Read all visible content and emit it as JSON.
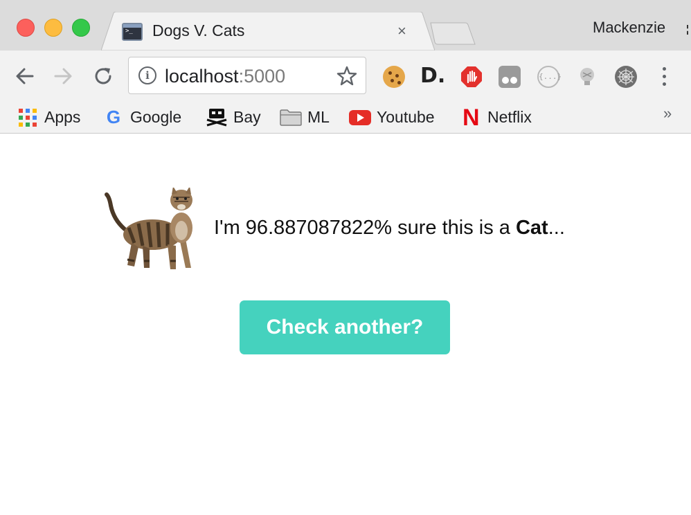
{
  "tab": {
    "title": "Dogs V. Cats",
    "close_glyph": "×",
    "favicon": "terminal-icon"
  },
  "profile": {
    "name": "Mackenzie"
  },
  "toolbar": {
    "back_icon": "arrow-left-icon",
    "forward_icon": "arrow-right-icon",
    "reload_icon": "reload-icon",
    "url_host": "localhost",
    "url_port": ":5000",
    "info_glyph": "i",
    "star_icon": "star-outline-icon",
    "extensions": [
      "cookie-icon",
      "d-logo-icon",
      "stop-hand-icon",
      "glasses-icon",
      "json-braces-icon",
      "bulb-icon",
      "web-icon"
    ],
    "json_glyph": "{...}",
    "d_glyph": "D."
  },
  "bookmarks": {
    "items": [
      {
        "label": "Apps",
        "icon": "apps-grid-icon"
      },
      {
        "label": "Google",
        "icon": "google-icon",
        "glyph": "G"
      },
      {
        "label": "Bay",
        "icon": "pirate-bay-icon"
      },
      {
        "label": "ML",
        "icon": "folder-icon"
      },
      {
        "label": "Youtube",
        "icon": "youtube-icon"
      },
      {
        "label": "Netflix",
        "icon": "netflix-icon",
        "glyph": "N"
      }
    ],
    "more_glyph": "»"
  },
  "main": {
    "result_prefix": "I'm 96.887087822% sure this is a ",
    "result_label": "Cat",
    "result_suffix": "...",
    "button_label": "Check another?"
  },
  "colors": {
    "button": "#45d2be",
    "tab_strip": "#dcdcdc",
    "toolbar": "#f2f2f2"
  }
}
